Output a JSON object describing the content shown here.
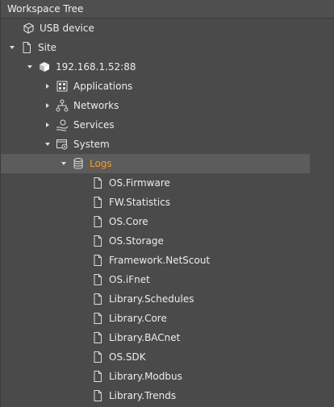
{
  "panel": {
    "title": "Workspace Tree"
  },
  "tree": {
    "usb_device": "USB device",
    "site": "Site",
    "device": "192.168.1.52:88",
    "applications": "Applications",
    "networks": "Networks",
    "services": "Services",
    "system": "System",
    "logs": "Logs",
    "log_items": [
      "OS.Firmware",
      "FW.Statistics",
      "OS.Core",
      "OS.Storage",
      "Framework.NetScout",
      "OS.iFnet",
      "Library.Schedules",
      "Library.Core",
      "Library.BACnet",
      "OS.SDK",
      "Library.Modbus",
      "Library.Trends"
    ]
  },
  "colors": {
    "background": "#4a4a4a",
    "selected_text": "#ff9a1f",
    "selected_row": "#5c5c5c"
  }
}
